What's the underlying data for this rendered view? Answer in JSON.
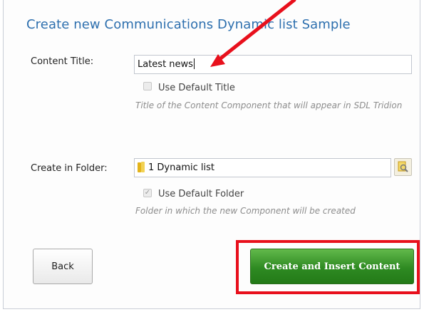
{
  "dialog": {
    "title": "Create new Communications Dynamic list Sample"
  },
  "content_title": {
    "label": "Content Title:",
    "value": "Latest news",
    "use_default_label": "Use Default Title",
    "use_default_checked": false,
    "hint": "Title of the Content Component that will appear in SDL Tridion"
  },
  "folder": {
    "label": "Create in Folder:",
    "value": "1 Dynamic list",
    "folder_icon": "folder-icon",
    "browse_icon": "browse-folder-icon",
    "use_default_label": "Use Default Folder",
    "use_default_checked": true,
    "hint": "Folder in which the new Component will be created"
  },
  "buttons": {
    "back_label": "Back",
    "create_label": "Create and Insert Content"
  },
  "colors": {
    "title": "#2d6fae",
    "primary_button": "#2e8a22",
    "annotation": "#e8101c"
  }
}
